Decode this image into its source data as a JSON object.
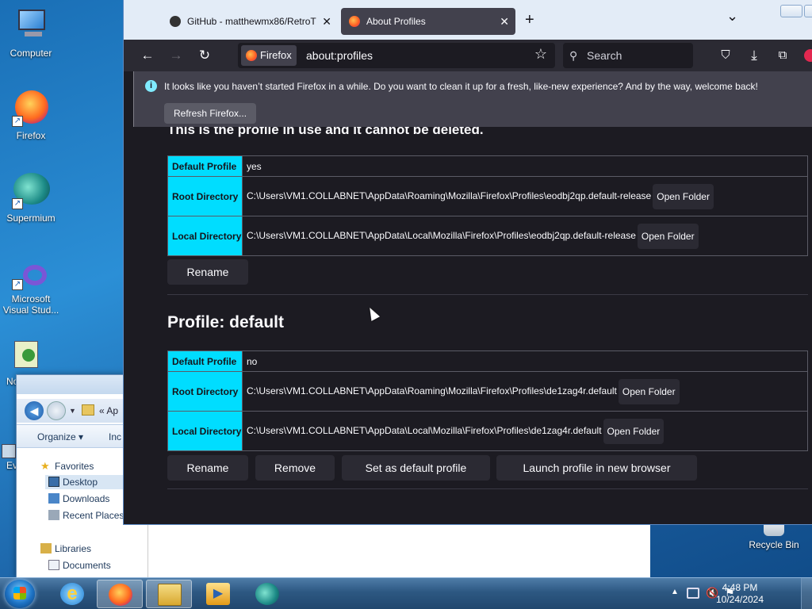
{
  "desktop": {
    "icons": [
      {
        "label": "Computer"
      },
      {
        "label": "Firefox"
      },
      {
        "label": "Supermium"
      },
      {
        "label": "Microsoft Visual Stud..."
      },
      {
        "label": "No"
      },
      {
        "label": "Ev"
      },
      {
        "label": "Recycle Bin"
      }
    ]
  },
  "explorer": {
    "address": "« Ap",
    "toolbar": {
      "organize": "Organize ▾",
      "include": "Inc"
    },
    "nav": {
      "favorites": "Favorites",
      "desktop": "Desktop",
      "downloads": "Downloads",
      "recent_places": "Recent Places",
      "libraries": "Libraries",
      "documents": "Documents"
    }
  },
  "firefox": {
    "tabs": [
      {
        "label": "GitHub - matthewmx86/RetroT",
        "close": "✕",
        "active": false
      },
      {
        "label": "About Profiles",
        "close": "✕",
        "active": true
      }
    ],
    "new_tab": "+",
    "tab_list": "⌄",
    "identity_label": "Firefox",
    "url": "about:profiles",
    "search_placeholder": "Search",
    "notification": {
      "text": "It looks like you haven’t started Firefox in a while. Do you want to clean it up for a fresh, like-new experience? And by the way, welcome back!",
      "button": "Refresh Firefox..."
    },
    "page": {
      "cut_heading": "This is the profile in use and it cannot be deleted.",
      "profile1": {
        "rows": [
          {
            "label": "Default Profile",
            "value": "yes"
          },
          {
            "label": "Root Directory",
            "value": "C:\\Users\\VM1.COLLABNET\\AppData\\Roaming\\Mozilla\\Firefox\\Profiles\\eodbj2qp.default-release",
            "button": "Open Folder"
          },
          {
            "label": "Local Directory",
            "value": "C:\\Users\\VM1.COLLABNET\\AppData\\Local\\Mozilla\\Firefox\\Profiles\\eodbj2qp.default-release",
            "button": "Open Folder"
          }
        ],
        "rename": "Rename"
      },
      "profile2": {
        "heading": "Profile: default",
        "rows": [
          {
            "label": "Default Profile",
            "value": "no"
          },
          {
            "label": "Root Directory",
            "value": "C:\\Users\\VM1.COLLABNET\\AppData\\Roaming\\Mozilla\\Firefox\\Profiles\\de1zag4r.default",
            "button": "Open Folder"
          },
          {
            "label": "Local Directory",
            "value": "C:\\Users\\VM1.COLLABNET\\AppData\\Local\\Mozilla\\Firefox\\Profiles\\de1zag4r.default",
            "button": "Open Folder"
          }
        ],
        "rename": "Rename",
        "remove": "Remove",
        "set_default": "Set as default profile",
        "launch": "Launch profile in new browser"
      }
    }
  },
  "taskbar": {
    "time": "4:48 PM",
    "date": "10/24/2024"
  }
}
